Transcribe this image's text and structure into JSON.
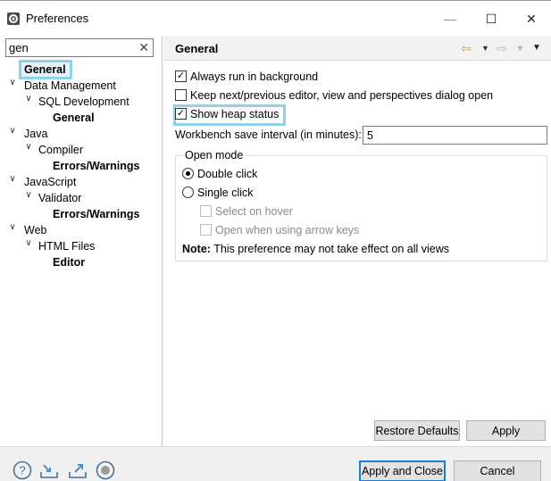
{
  "window": {
    "title": "Preferences",
    "minimize": "—",
    "maximize": "☐",
    "close": "✕",
    "app_icon": "preferences-gear-icon"
  },
  "filter": {
    "value": "gen",
    "clear": "✕"
  },
  "tree": [
    {
      "label": "General",
      "level": 0,
      "bold": true,
      "expander": ""
    },
    {
      "label": "Data Management",
      "level": 0,
      "bold": false,
      "expander": "∨"
    },
    {
      "label": "SQL Development",
      "level": 1,
      "bold": false,
      "expander": "∨"
    },
    {
      "label": "General",
      "level": 2,
      "bold": true,
      "expander": ""
    },
    {
      "label": "Java",
      "level": 0,
      "bold": false,
      "expander": "∨"
    },
    {
      "label": "Compiler",
      "level": 1,
      "bold": false,
      "expander": "∨"
    },
    {
      "label": "Errors/Warnings",
      "level": 2,
      "bold": true,
      "expander": ""
    },
    {
      "label": "JavaScript",
      "level": 0,
      "bold": false,
      "expander": "∨"
    },
    {
      "label": "Validator",
      "level": 1,
      "bold": false,
      "expander": "∨"
    },
    {
      "label": "Errors/Warnings",
      "level": 2,
      "bold": true,
      "expander": ""
    },
    {
      "label": "Web",
      "level": 0,
      "bold": false,
      "expander": "∨"
    },
    {
      "label": "HTML Files",
      "level": 1,
      "bold": false,
      "expander": "∨"
    },
    {
      "label": "Editor",
      "level": 2,
      "bold": true,
      "expander": ""
    }
  ],
  "page": {
    "title": "General",
    "nav": {
      "back": "⇦",
      "back_menu": "▼",
      "forward": "⇨",
      "forward_menu": "▼",
      "view_menu": "▼"
    },
    "options": {
      "always_run_background": {
        "label": "Always run in background",
        "checked": true
      },
      "keep_next_prev": {
        "label": "Keep next/previous editor, view and perspectives dialog open",
        "checked": false
      },
      "show_heap_status": {
        "label": "Show heap status",
        "checked": true
      }
    },
    "save_interval": {
      "label": "Workbench save interval (in minutes):",
      "value": "5"
    },
    "open_mode": {
      "title": "Open mode",
      "double_click": {
        "label": "Double click",
        "selected": true
      },
      "single_click": {
        "label": "Single click",
        "selected": false
      },
      "select_on_hover": {
        "label": "Select on hover",
        "checked": false,
        "enabled": false
      },
      "open_arrow_keys": {
        "label": "Open when using arrow keys",
        "checked": false,
        "enabled": false
      },
      "note_label": "Note:",
      "note_text": "This preference may not take effect on all views"
    },
    "restore_defaults": "Restore Defaults",
    "apply": "Apply"
  },
  "footer": {
    "apply_and_close": "Apply and Close",
    "cancel": "Cancel",
    "icons": [
      "help-icon",
      "import-icon",
      "export-icon",
      "record-icon"
    ]
  },
  "colors": {
    "highlight": "#8fd3ea",
    "primary_border": "#1a7fd4",
    "back_arrow": "#e3a21a"
  }
}
